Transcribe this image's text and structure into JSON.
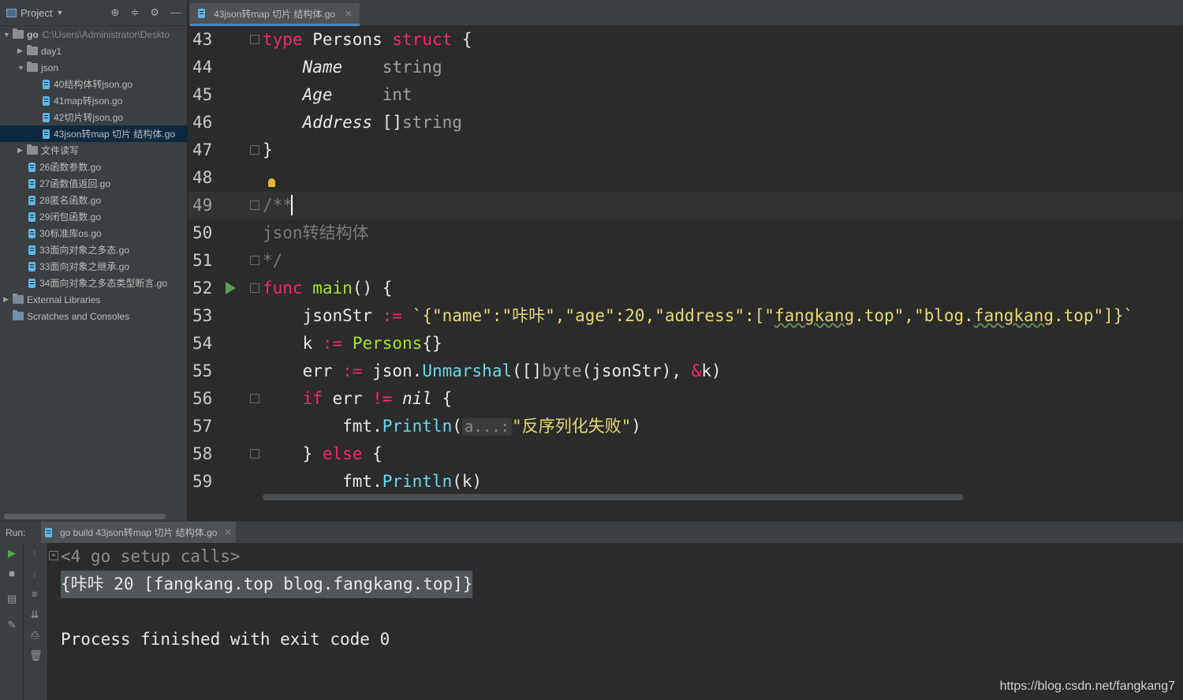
{
  "project": {
    "title": "Project",
    "tree": [
      {
        "label": "go",
        "extra": "C:\\Users\\Administrator\\Deskto",
        "kind": "folder",
        "open": true,
        "depth": 0
      },
      {
        "label": "day1",
        "kind": "folder",
        "open": false,
        "depth": 1
      },
      {
        "label": "json",
        "kind": "folder",
        "open": true,
        "depth": 1
      },
      {
        "label": "40结构体转json.go",
        "kind": "file",
        "depth": 2
      },
      {
        "label": "41map转json.go",
        "kind": "file",
        "depth": 2
      },
      {
        "label": "42切片转json.go",
        "kind": "file",
        "depth": 2
      },
      {
        "label": "43json转map 切片 结构体.go",
        "kind": "file",
        "depth": 2,
        "selected": true
      },
      {
        "label": "文件读写",
        "kind": "folder",
        "open": false,
        "depth": 1
      },
      {
        "label": "26函数参数.go",
        "kind": "file",
        "depth": 1
      },
      {
        "label": "27函数值返回.go",
        "kind": "file",
        "depth": 1
      },
      {
        "label": "28匿名函数.go",
        "kind": "file",
        "depth": 1
      },
      {
        "label": "29闭包函数.go",
        "kind": "file",
        "depth": 1
      },
      {
        "label": "30标准库os.go",
        "kind": "file",
        "depth": 1
      },
      {
        "label": "33面向对象之多态.go",
        "kind": "file",
        "depth": 1
      },
      {
        "label": "33面向对象之继承.go",
        "kind": "file",
        "depth": 1
      },
      {
        "label": "34面向对象之多态类型断言.go",
        "kind": "file",
        "depth": 1
      },
      {
        "label": "External Libraries",
        "kind": "lib",
        "open": false,
        "depth": 0
      },
      {
        "label": "Scratches and Consoles",
        "kind": "scratch",
        "depth": 0
      }
    ]
  },
  "editor": {
    "tab": "43json转map 切片 结构体.go",
    "line_numbers": [
      "43",
      "44",
      "45",
      "46",
      "47",
      "48",
      "49",
      "50",
      "51",
      "52",
      "53",
      "54",
      "55",
      "56",
      "57",
      "58",
      "59"
    ],
    "l53": {
      "var": "jsonStr",
      "op": ":=",
      "str1": "`{\"name\":\"咔咔\",\"age\":20,\"address\":[\"",
      "u1": "fangkang",
      "str2": ".top\",\"blog.",
      "u2": "fangkang",
      "str3": ".top\"]}`"
    },
    "comment_open": "/**",
    "comment_body": "json转结构体",
    "comment_close": "*/",
    "hint": "a...:",
    "str_fail": "\"反序列化失败\""
  },
  "run": {
    "label": "Run:",
    "tab": "go build 43json转map 切片 结构体.go",
    "lines": [
      "<4 go setup calls>",
      "{咔咔 20 [fangkang.top blog.fangkang.top]}",
      "",
      "Process finished with exit code 0"
    ]
  },
  "watermark": "https://blog.csdn.net/fangkang7"
}
